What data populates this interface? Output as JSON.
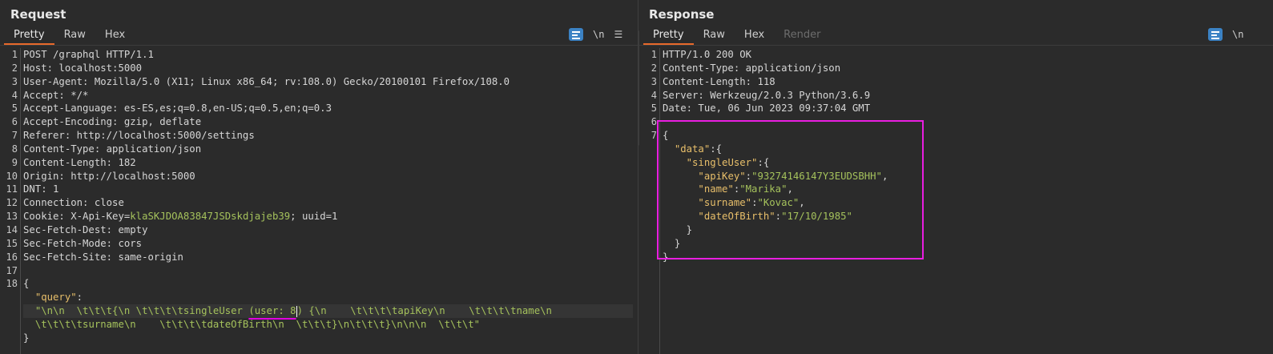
{
  "request": {
    "title": "Request",
    "tabs": [
      "Pretty",
      "Raw",
      "Hex"
    ],
    "active_tab": "Pretty",
    "tools": {
      "newline_toggle": "\\n",
      "menu_icon": "☰",
      "wrap_icon": "wrap-lines-icon"
    },
    "line_numbers": [
      "1",
      "2",
      "3",
      "4",
      "5",
      "6",
      "7",
      "8",
      "9",
      "10",
      "11",
      "12",
      "13",
      "14",
      "15",
      "16",
      "17",
      "18",
      "",
      "",
      ""
    ],
    "lines": {
      "l1": "POST /graphql HTTP/1.1",
      "l2": "Host: localhost:5000",
      "l3": "User-Agent: Mozilla/5.0 (X11; Linux x86_64; rv:108.0) Gecko/20100101 Firefox/108.0",
      "l4": "Accept: */*",
      "l5": "Accept-Language: es-ES,es;q=0.8,en-US;q=0.5,en;q=0.3",
      "l6": "Accept-Encoding: gzip, deflate",
      "l7": "Referer: http://localhost:5000/settings",
      "l8": "Content-Type: application/json",
      "l9": "Content-Length: 182",
      "l10": "Origin: http://localhost:5000",
      "l11": "DNT: 1",
      "l12": "Connection: close",
      "l13_name": "Cookie: ",
      "l13_key": "X-Api-Key",
      "l13_eq": "=",
      "l13_val": "klaSKJDOA83847JSDskdjajeb39",
      "l13_rest": "; uuid=1",
      "l14": "Sec-Fetch-Dest: empty",
      "l15": "Sec-Fetch-Mode: cors",
      "l16": "Sec-Fetch-Site: same-origin",
      "l17": "",
      "l18": "{",
      "l19_key": "\"query\"",
      "l19_colon": ":",
      "l20_a": "\"\\n\\n  \\t\\t\\t{\\n \\t\\t\\t\\tsingleUser ",
      "l20_b": "(user: 8",
      "l20_c": ") {\\n    \\t\\t\\t\\tapiKey\\n    \\t\\t\\t\\tname\\n",
      "l21": "\\t\\t\\t\\tsurname\\n    \\t\\t\\t\\tdateOfBirth\\n  \\t\\t\\t}\\n\\t\\t\\t}\\n\\n\\n  \\t\\t\\t\"",
      "l22": "}"
    }
  },
  "response": {
    "title": "Response",
    "tabs": [
      "Pretty",
      "Raw",
      "Hex",
      "Render"
    ],
    "active_tab": "Pretty",
    "tools": {
      "newline_toggle": "\\n",
      "wrap_icon": "wrap-lines-icon"
    },
    "line_numbers": [
      "1",
      "2",
      "3",
      "4",
      "5",
      "6",
      "7"
    ],
    "lines": {
      "l1": "HTTP/1.0 200 OK",
      "l2": "Content-Type: application/json",
      "l3": "Content-Length: 118",
      "l4": "Server: Werkzeug/2.0.3 Python/3.6.9",
      "l5": "Date: Tue, 06 Jun 2023 09:37:04 GMT",
      "l6": "",
      "l7": "{",
      "data_key": "\"data\"",
      "single_key": "\"singleUser\"",
      "apikey_key": "\"apiKey\"",
      "apikey_val": "\"93274146147Y3EUDSBHH\"",
      "name_key": "\"name\"",
      "name_val": "\"Marika\"",
      "surname_key": "\"surname\"",
      "surname_val": "\"Kovac\"",
      "dob_key": "\"dateOfBirth\"",
      "dob_val": "\"17/10/1985\"",
      "close1": "}",
      "close2": "}",
      "close3": "}"
    }
  },
  "colors": {
    "accent": "#e8692b",
    "highlight": "#e91ee0",
    "string": "#a5c25c",
    "key": "#e8bf6a",
    "button": "#3b82c4"
  }
}
